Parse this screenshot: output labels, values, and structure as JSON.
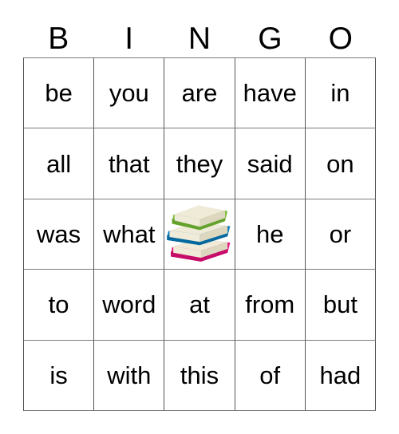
{
  "card": {
    "header_letters": [
      "B",
      "I",
      "N",
      "G",
      "O"
    ],
    "rows": [
      [
        {
          "type": "word",
          "text": "be"
        },
        {
          "type": "word",
          "text": "you"
        },
        {
          "type": "word",
          "text": "are"
        },
        {
          "type": "word",
          "text": "have"
        },
        {
          "type": "word",
          "text": "in"
        }
      ],
      [
        {
          "type": "word",
          "text": "all"
        },
        {
          "type": "word",
          "text": "that"
        },
        {
          "type": "word",
          "text": "they"
        },
        {
          "type": "word",
          "text": "said"
        },
        {
          "type": "word",
          "text": "on"
        }
      ],
      [
        {
          "type": "word",
          "text": "was"
        },
        {
          "type": "word",
          "text": "what"
        },
        {
          "type": "image",
          "text": "",
          "icon": "stack-of-books-icon"
        },
        {
          "type": "word",
          "text": "he"
        },
        {
          "type": "word",
          "text": "or"
        }
      ],
      [
        {
          "type": "word",
          "text": "to"
        },
        {
          "type": "word",
          "text": "word"
        },
        {
          "type": "word",
          "text": "at"
        },
        {
          "type": "word",
          "text": "from"
        },
        {
          "type": "word",
          "text": "but"
        }
      ],
      [
        {
          "type": "word",
          "text": "is"
        },
        {
          "type": "word",
          "text": "with"
        },
        {
          "type": "word",
          "text": "this"
        },
        {
          "type": "word",
          "text": "of"
        },
        {
          "type": "word",
          "text": "had"
        }
      ]
    ]
  },
  "colors": {
    "book_green": "#7DBF3C",
    "book_green_dark": "#63A22C",
    "book_blue": "#0878B8",
    "book_blue_dark": "#05689F",
    "book_pink": "#E8107E",
    "book_pink_dark": "#C60C69",
    "page_cream": "#EFEBD8",
    "page_cream_shade": "#DCD7BE",
    "grid_border": "#555555",
    "text": "#000000",
    "background": "#FFFFFF"
  }
}
